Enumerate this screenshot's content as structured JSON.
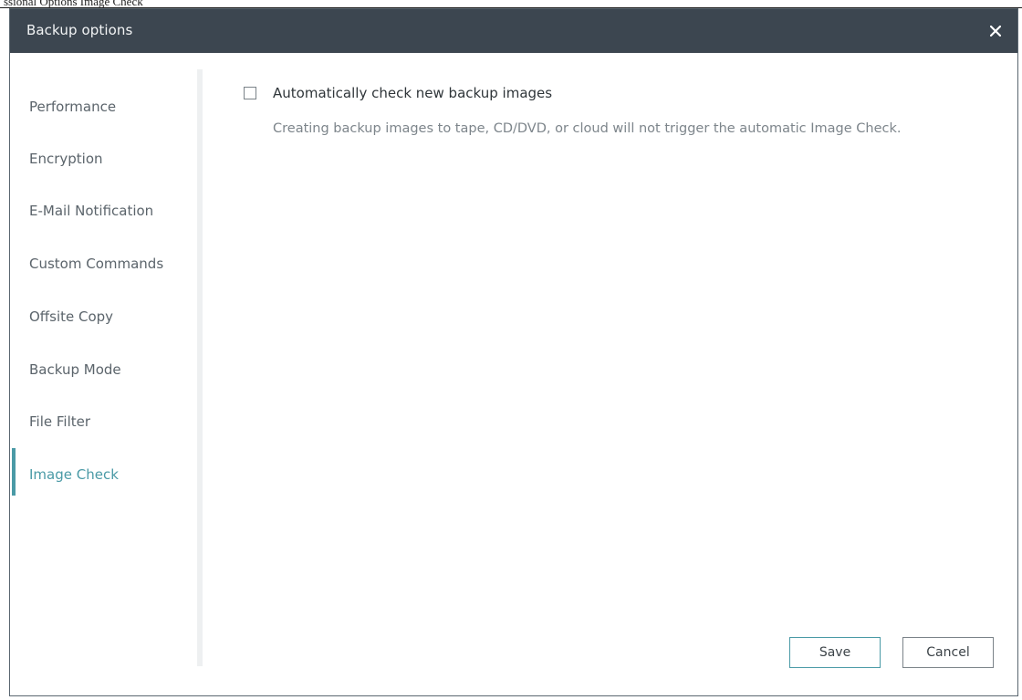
{
  "top_strip": {
    "text": "ssional Options Image Check"
  },
  "dialog": {
    "title": "Backup options",
    "close_icon": "close-icon"
  },
  "sidebar": {
    "active_index": 7,
    "items": [
      {
        "label": "Performance"
      },
      {
        "label": "Encryption"
      },
      {
        "label": "E-Mail Notification"
      },
      {
        "label": "Custom Commands"
      },
      {
        "label": "Offsite Copy"
      },
      {
        "label": "Backup Mode"
      },
      {
        "label": "File Filter"
      },
      {
        "label": "Image Check"
      }
    ]
  },
  "content": {
    "auto_check_label": "Automatically check new backup images",
    "auto_check_checked": false,
    "hint": "Creating backup images to tape, CD/DVD, or cloud will not trigger the automatic Image Check."
  },
  "buttons": {
    "save_label": "Save",
    "cancel_label": "Cancel"
  },
  "colors": {
    "titlebar": "#3c4650",
    "accent": "#4a9aa6"
  }
}
